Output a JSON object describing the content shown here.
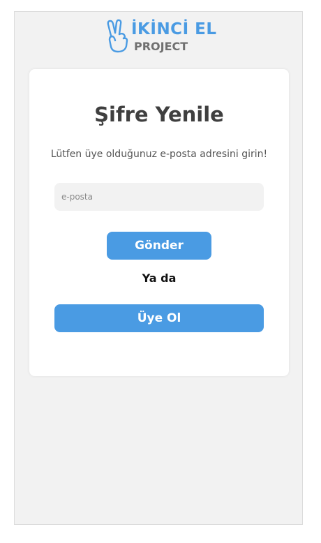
{
  "brand": {
    "line1": "İKİNCİ EL",
    "line2": "PROJECT",
    "icon": "peace-hand-icon",
    "color": "#4a9be3"
  },
  "form": {
    "title": "Şifre Yenile",
    "instruction": "Lütfen üye olduğunuz e-posta adresini girin!",
    "email_placeholder": "e-posta",
    "email_value": "",
    "send_label": "Gönder",
    "or_label": "Ya da",
    "signup_label": "Üye Ol"
  },
  "colors": {
    "accent": "#4a9be3",
    "background": "#f2f2f2",
    "card": "#ffffff"
  }
}
